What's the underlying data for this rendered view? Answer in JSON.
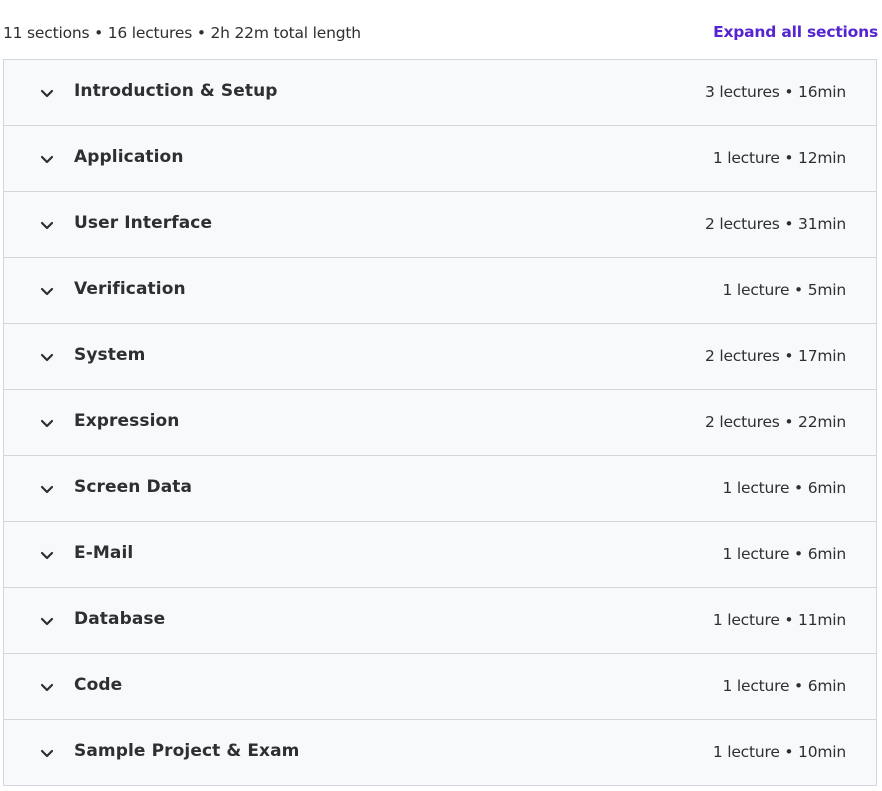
{
  "header": {
    "summary": "11 sections • 16 lectures • 2h 22m total length",
    "expand_label": "Expand all sections"
  },
  "icons": {
    "section_toggle": "chevron-down-icon"
  },
  "colors": {
    "accent": "#5624d0",
    "row_background": "#f7f9fa",
    "border": "#d1d7dc",
    "text": "#2d2f31"
  },
  "sections": [
    {
      "title": "Introduction & Setup",
      "meta": "3 lectures • 16min"
    },
    {
      "title": "Application",
      "meta": "1 lecture • 12min"
    },
    {
      "title": "User Interface",
      "meta": "2 lectures • 31min"
    },
    {
      "title": "Verification",
      "meta": "1 lecture • 5min"
    },
    {
      "title": "System",
      "meta": "2 lectures • 17min"
    },
    {
      "title": "Expression",
      "meta": "2 lectures • 22min"
    },
    {
      "title": "Screen Data",
      "meta": "1 lecture • 6min"
    },
    {
      "title": "E-Mail",
      "meta": "1 lecture • 6min"
    },
    {
      "title": "Database",
      "meta": "1 lecture • 11min"
    },
    {
      "title": "Code",
      "meta": "1 lecture • 6min"
    },
    {
      "title": "Sample Project & Exam",
      "meta": "1 lecture • 10min"
    }
  ]
}
